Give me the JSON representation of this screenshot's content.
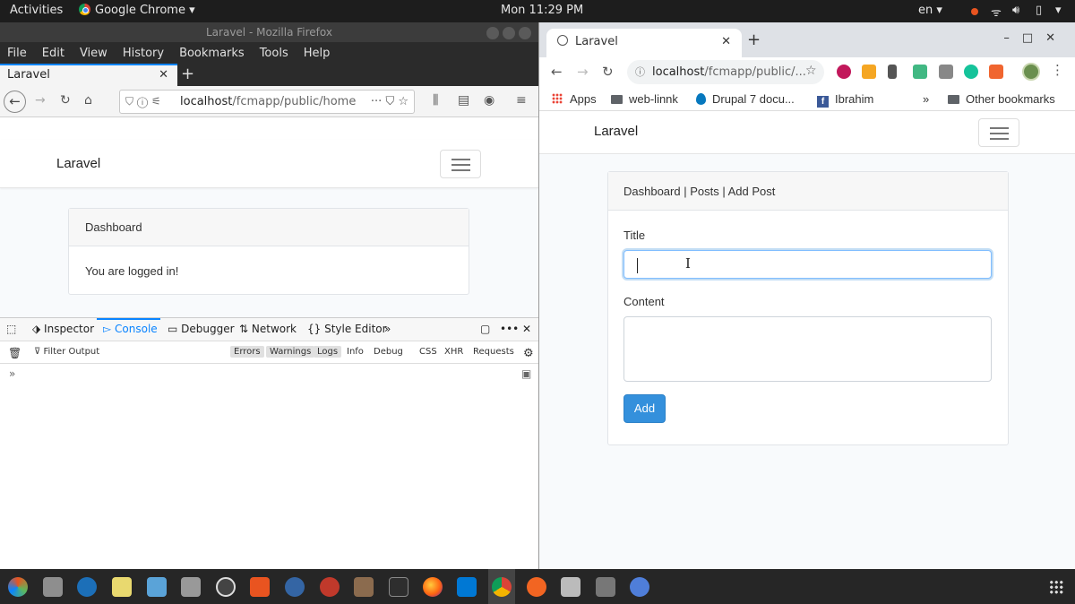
{
  "topbar": {
    "activities": "Activities",
    "app_name": "Google Chrome",
    "clock": "Mon 11:29 PM",
    "language": "en"
  },
  "firefox": {
    "window_title": "Laravel - Mozilla Firefox",
    "menu": [
      "File",
      "Edit",
      "View",
      "History",
      "Bookmarks",
      "Tools",
      "Help"
    ],
    "tab_title": "Laravel",
    "url_host": "localhost",
    "url_path": "/fcmapp/public/home",
    "page": {
      "brand": "Laravel",
      "card_header": "Dashboard",
      "card_body": "You are logged in!"
    },
    "devtools": {
      "tabs": [
        "Inspector",
        "Console",
        "Debugger",
        "Network",
        "Style Editor"
      ],
      "selected_tab": "Console",
      "filter_placeholder": "Filter Output",
      "filters": [
        "Errors",
        "Warnings",
        "Logs",
        "Info",
        "Debug",
        "CSS",
        "XHR",
        "Requests"
      ],
      "active_filters": [
        "Errors",
        "Warnings",
        "Logs"
      ]
    }
  },
  "chrome": {
    "tab_title": "Laravel",
    "url_host": "localhost",
    "url_path": "/fcmapp/public/...",
    "bookmarks": [
      "Apps",
      "web-linnk",
      "Drupal 7 docu...",
      "Ibrahim",
      "Other bookmarks"
    ],
    "page": {
      "brand": "Laravel",
      "card_header": "Dashboard | Posts | Add Post",
      "title_label": "Title",
      "title_value": "",
      "content_label": "Content",
      "content_value": "",
      "submit_label": "Add"
    }
  },
  "colors": {
    "ubuntu_orange": "#e95420",
    "laravel_primary": "#3490dc",
    "firefox_blue": "#0a84ff"
  }
}
